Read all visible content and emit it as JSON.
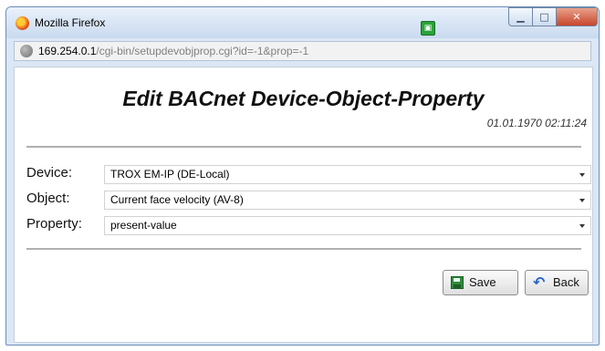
{
  "window": {
    "title": "Mozilla Firefox",
    "address": {
      "host": "169.254.0.1",
      "path": "/cgi-bin/setupdevobjprop.cgi?id=-1&prop=-1"
    }
  },
  "page": {
    "title": "Edit BACnet Device-Object-Property",
    "datetime": "01.01.1970 02:11:24"
  },
  "form": {
    "device": {
      "label": "Device:",
      "value": "TROX EM-IP (DE-Local)"
    },
    "object": {
      "label": "Object:",
      "value": "Current face velocity (AV-8)"
    },
    "property": {
      "label": "Property:",
      "value": "present-value"
    }
  },
  "buttons": {
    "save": "Save",
    "back": "Back"
  },
  "icons": {
    "window": [
      "firefox-icon",
      "tab-indicator-icon",
      "minimize-icon",
      "maximize-icon",
      "close-icon"
    ],
    "address": "globe-icon",
    "save": "floppy-save-icon",
    "back": "back-arrow-icon"
  }
}
